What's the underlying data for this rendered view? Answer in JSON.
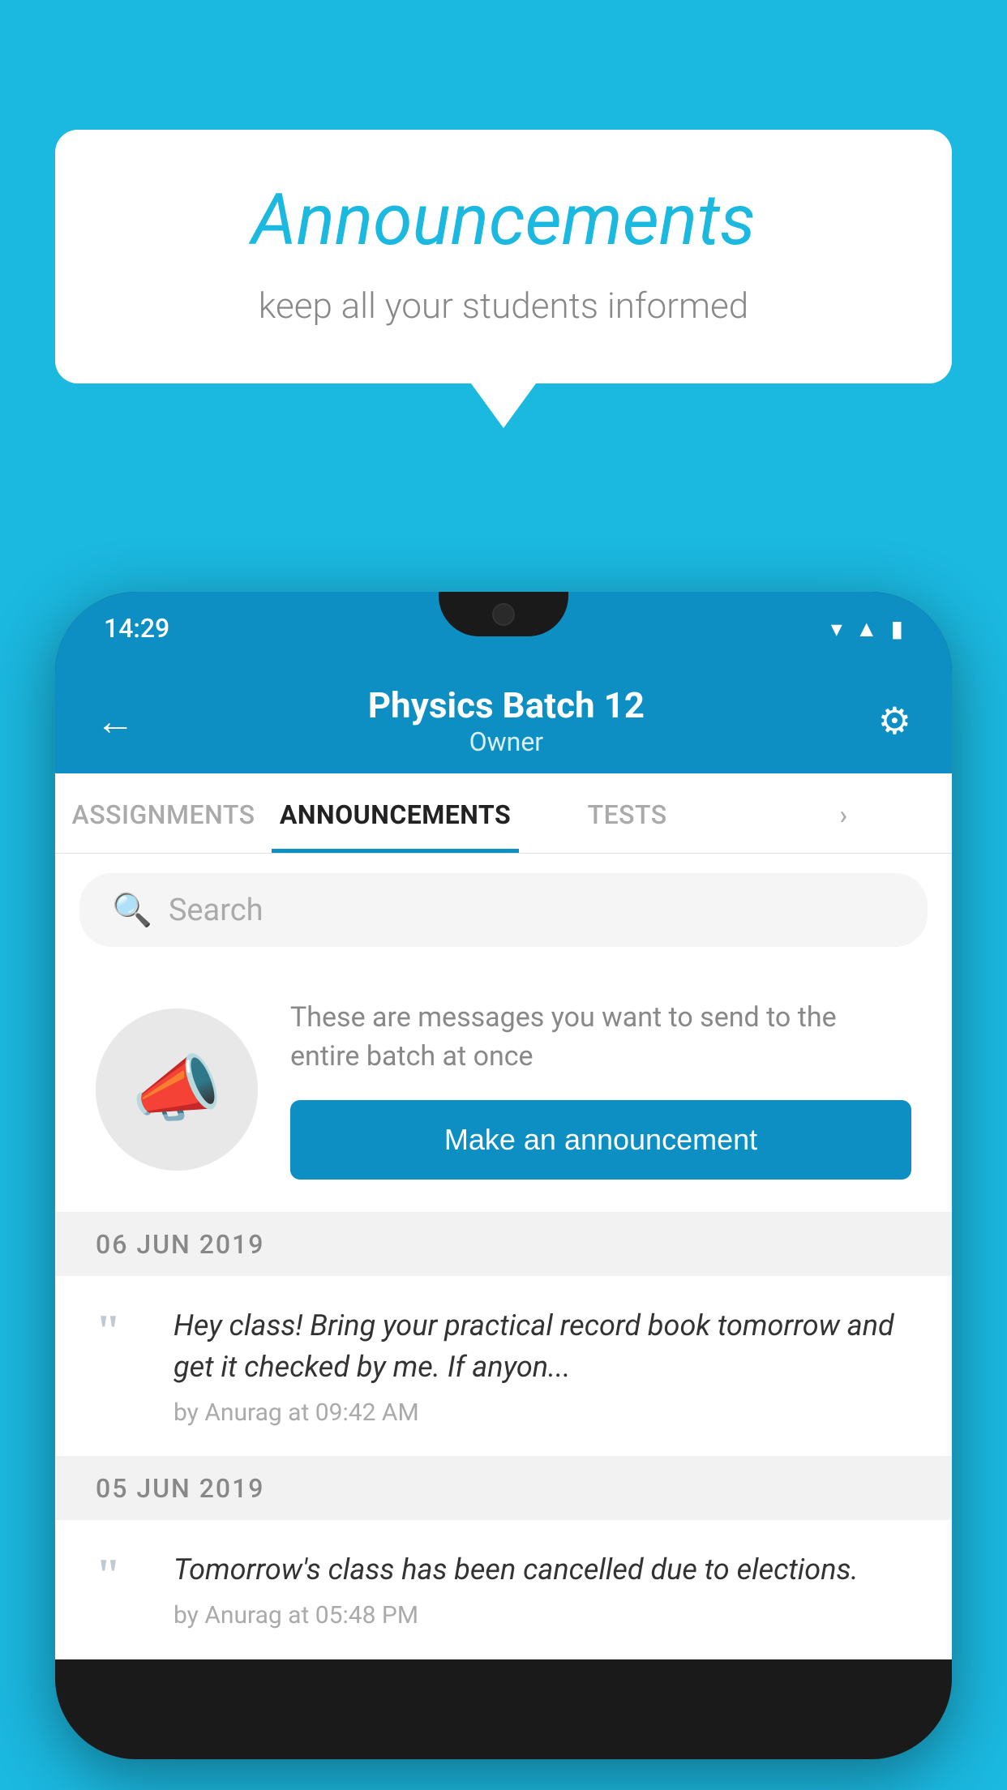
{
  "background_color": "#1bb8e0",
  "speech_bubble": {
    "title": "Announcements",
    "subtitle": "keep all your students informed"
  },
  "phone": {
    "status_bar": {
      "time": "14:29",
      "icons": [
        "wifi",
        "signal",
        "battery"
      ]
    },
    "header": {
      "back_label": "←",
      "title": "Physics Batch 12",
      "subtitle": "Owner",
      "gear_label": "⚙"
    },
    "tabs": [
      {
        "label": "ASSIGNMENTS",
        "active": false
      },
      {
        "label": "ANNOUNCEMENTS",
        "active": true
      },
      {
        "label": "TESTS",
        "active": false
      },
      {
        "label": "›",
        "active": false
      }
    ],
    "search": {
      "placeholder": "Search"
    },
    "announcement_prompt": {
      "description": "These are messages you want to send to the entire batch at once",
      "button_label": "Make an announcement"
    },
    "announcements": [
      {
        "date": "06  JUN  2019",
        "text": "Hey class! Bring your practical record book tomorrow and get it checked by me. If anyon...",
        "meta": "by Anurag at 09:42 AM"
      },
      {
        "date": "05  JUN  2019",
        "text": "Tomorrow's class has been cancelled due to elections.",
        "meta": "by Anurag at 05:48 PM"
      }
    ]
  }
}
